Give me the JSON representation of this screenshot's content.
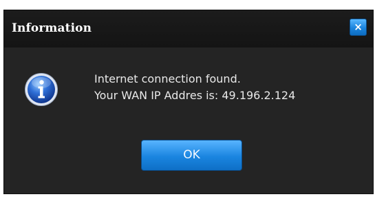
{
  "dialog": {
    "title": "Information",
    "close_label": "×",
    "icon": "info-icon",
    "message_line1": "Internet connection found.",
    "message_line2": "Your WAN IP Addres is: 49.196.2.124",
    "ok_label": "OK"
  },
  "colors": {
    "background": "#242424",
    "titlebar": "#171717",
    "accent": "#1a85e0",
    "text": "#e9e9e9"
  }
}
